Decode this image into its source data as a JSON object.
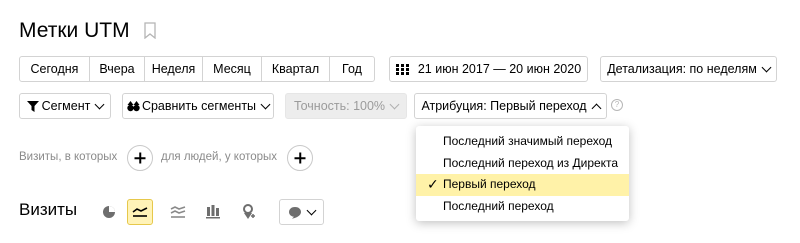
{
  "page": {
    "title": "Метки UTM"
  },
  "periods": [
    "Сегодня",
    "Вчера",
    "Неделя",
    "Месяц",
    "Квартал",
    "Год"
  ],
  "date_range": "21 июн 2017 — 20 июн 2020",
  "detail": "Детализация: по неделям",
  "segment": "Сегмент",
  "compare": "Сравнить сегменты",
  "accuracy": "Точность: 100%",
  "attribution": "Атрибуция: Первый переход",
  "help": "?",
  "filter": {
    "visits_label": "Визиты, в которых",
    "people_label": "для людей, у которых"
  },
  "section": {
    "title": "Визиты"
  },
  "dropdown": {
    "items": [
      "Последний значимый переход",
      "Последний переход из Директа",
      "Первый переход",
      "Последний переход"
    ],
    "selected_index": 2,
    "check": "✓"
  },
  "colors": {
    "selected_bg": "#fff2a8",
    "active_icon_bg": "#fff3b8",
    "border": "#d3d3d3"
  }
}
